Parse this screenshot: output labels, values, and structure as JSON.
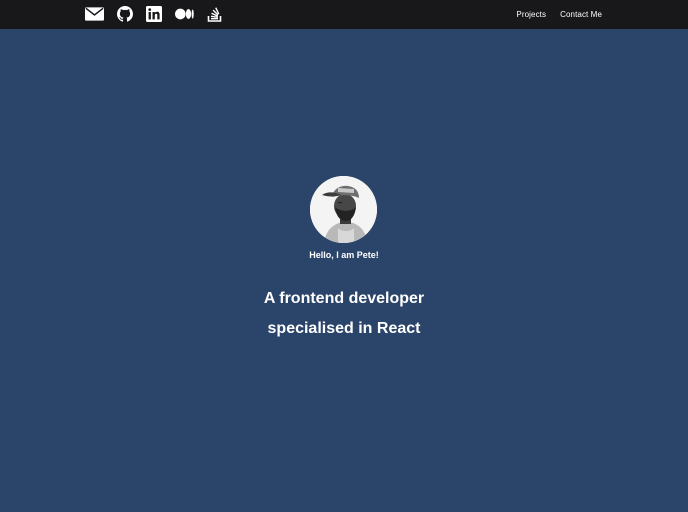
{
  "header": {
    "social_icons": [
      "envelope-icon",
      "github-icon",
      "linkedin-icon",
      "medium-icon",
      "stackoverflow-icon"
    ],
    "nav": {
      "projects_label": "Projects",
      "contact_label": "Contact Me"
    }
  },
  "hero": {
    "greeting": "Hello, I am Pete!",
    "headline_line1": "A frontend developer",
    "headline_line2": "specialised in React"
  },
  "colors": {
    "header_bg": "#18181b",
    "page_bg": "#2b446a",
    "text": "#ffffff"
  }
}
